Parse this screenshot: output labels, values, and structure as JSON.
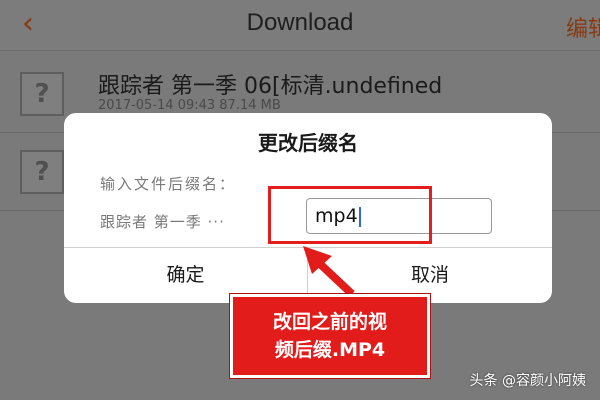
{
  "nav": {
    "back_icon": "chevron-left-icon",
    "back_glyph": "‹",
    "title": "Download",
    "edit_label": "编辑"
  },
  "files": [
    {
      "name": "跟踪者 第一季 06[标清.undefined",
      "meta": "2017-05-14 09:43   87.14 MB",
      "icon_glyph": "?"
    },
    {
      "name": "",
      "meta": "",
      "icon_glyph": "?"
    }
  ],
  "dialog": {
    "title": "更改后缀名",
    "prompt": "输入文件后缀名：",
    "filename_label": "跟踪者 第一季 ···",
    "input_value": "mp4",
    "ok_label": "确定",
    "cancel_label": "取消"
  },
  "annotation": {
    "callout_line1": "改回之前的视",
    "callout_line2": "频后缀.MP4",
    "color": "#e21b1b"
  },
  "watermark": "头条 @容颜小阿姨"
}
